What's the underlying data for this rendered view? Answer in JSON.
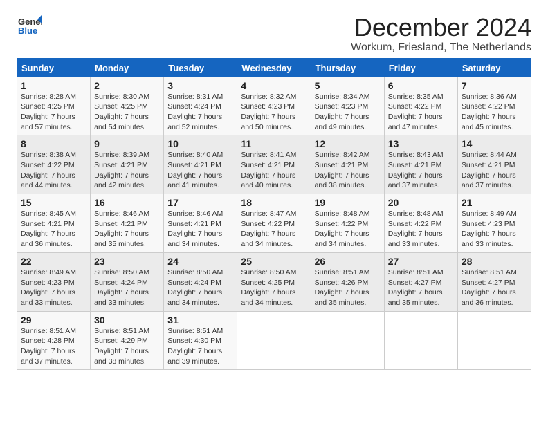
{
  "logo": {
    "line1": "General",
    "line2": "Blue"
  },
  "title": "December 2024",
  "subtitle": "Workum, Friesland, The Netherlands",
  "weekdays": [
    "Sunday",
    "Monday",
    "Tuesday",
    "Wednesday",
    "Thursday",
    "Friday",
    "Saturday"
  ],
  "weeks": [
    [
      {
        "day": "1",
        "sunrise": "8:28 AM",
        "sunset": "4:25 PM",
        "daylight": "7 hours and 57 minutes."
      },
      {
        "day": "2",
        "sunrise": "8:30 AM",
        "sunset": "4:25 PM",
        "daylight": "7 hours and 54 minutes."
      },
      {
        "day": "3",
        "sunrise": "8:31 AM",
        "sunset": "4:24 PM",
        "daylight": "7 hours and 52 minutes."
      },
      {
        "day": "4",
        "sunrise": "8:32 AM",
        "sunset": "4:23 PM",
        "daylight": "7 hours and 50 minutes."
      },
      {
        "day": "5",
        "sunrise": "8:34 AM",
        "sunset": "4:23 PM",
        "daylight": "7 hours and 49 minutes."
      },
      {
        "day": "6",
        "sunrise": "8:35 AM",
        "sunset": "4:22 PM",
        "daylight": "7 hours and 47 minutes."
      },
      {
        "day": "7",
        "sunrise": "8:36 AM",
        "sunset": "4:22 PM",
        "daylight": "7 hours and 45 minutes."
      }
    ],
    [
      {
        "day": "8",
        "sunrise": "8:38 AM",
        "sunset": "4:22 PM",
        "daylight": "7 hours and 44 minutes."
      },
      {
        "day": "9",
        "sunrise": "8:39 AM",
        "sunset": "4:21 PM",
        "daylight": "7 hours and 42 minutes."
      },
      {
        "day": "10",
        "sunrise": "8:40 AM",
        "sunset": "4:21 PM",
        "daylight": "7 hours and 41 minutes."
      },
      {
        "day": "11",
        "sunrise": "8:41 AM",
        "sunset": "4:21 PM",
        "daylight": "7 hours and 40 minutes."
      },
      {
        "day": "12",
        "sunrise": "8:42 AM",
        "sunset": "4:21 PM",
        "daylight": "7 hours and 38 minutes."
      },
      {
        "day": "13",
        "sunrise": "8:43 AM",
        "sunset": "4:21 PM",
        "daylight": "7 hours and 37 minutes."
      },
      {
        "day": "14",
        "sunrise": "8:44 AM",
        "sunset": "4:21 PM",
        "daylight": "7 hours and 37 minutes."
      }
    ],
    [
      {
        "day": "15",
        "sunrise": "8:45 AM",
        "sunset": "4:21 PM",
        "daylight": "7 hours and 36 minutes."
      },
      {
        "day": "16",
        "sunrise": "8:46 AM",
        "sunset": "4:21 PM",
        "daylight": "7 hours and 35 minutes."
      },
      {
        "day": "17",
        "sunrise": "8:46 AM",
        "sunset": "4:21 PM",
        "daylight": "7 hours and 34 minutes."
      },
      {
        "day": "18",
        "sunrise": "8:47 AM",
        "sunset": "4:22 PM",
        "daylight": "7 hours and 34 minutes."
      },
      {
        "day": "19",
        "sunrise": "8:48 AM",
        "sunset": "4:22 PM",
        "daylight": "7 hours and 34 minutes."
      },
      {
        "day": "20",
        "sunrise": "8:48 AM",
        "sunset": "4:22 PM",
        "daylight": "7 hours and 33 minutes."
      },
      {
        "day": "21",
        "sunrise": "8:49 AM",
        "sunset": "4:23 PM",
        "daylight": "7 hours and 33 minutes."
      }
    ],
    [
      {
        "day": "22",
        "sunrise": "8:49 AM",
        "sunset": "4:23 PM",
        "daylight": "7 hours and 33 minutes."
      },
      {
        "day": "23",
        "sunrise": "8:50 AM",
        "sunset": "4:24 PM",
        "daylight": "7 hours and 33 minutes."
      },
      {
        "day": "24",
        "sunrise": "8:50 AM",
        "sunset": "4:24 PM",
        "daylight": "7 hours and 34 minutes."
      },
      {
        "day": "25",
        "sunrise": "8:50 AM",
        "sunset": "4:25 PM",
        "daylight": "7 hours and 34 minutes."
      },
      {
        "day": "26",
        "sunrise": "8:51 AM",
        "sunset": "4:26 PM",
        "daylight": "7 hours and 35 minutes."
      },
      {
        "day": "27",
        "sunrise": "8:51 AM",
        "sunset": "4:27 PM",
        "daylight": "7 hours and 35 minutes."
      },
      {
        "day": "28",
        "sunrise": "8:51 AM",
        "sunset": "4:27 PM",
        "daylight": "7 hours and 36 minutes."
      }
    ],
    [
      {
        "day": "29",
        "sunrise": "8:51 AM",
        "sunset": "4:28 PM",
        "daylight": "7 hours and 37 minutes."
      },
      {
        "day": "30",
        "sunrise": "8:51 AM",
        "sunset": "4:29 PM",
        "daylight": "7 hours and 38 minutes."
      },
      {
        "day": "31",
        "sunrise": "8:51 AM",
        "sunset": "4:30 PM",
        "daylight": "7 hours and 39 minutes."
      },
      null,
      null,
      null,
      null
    ]
  ]
}
